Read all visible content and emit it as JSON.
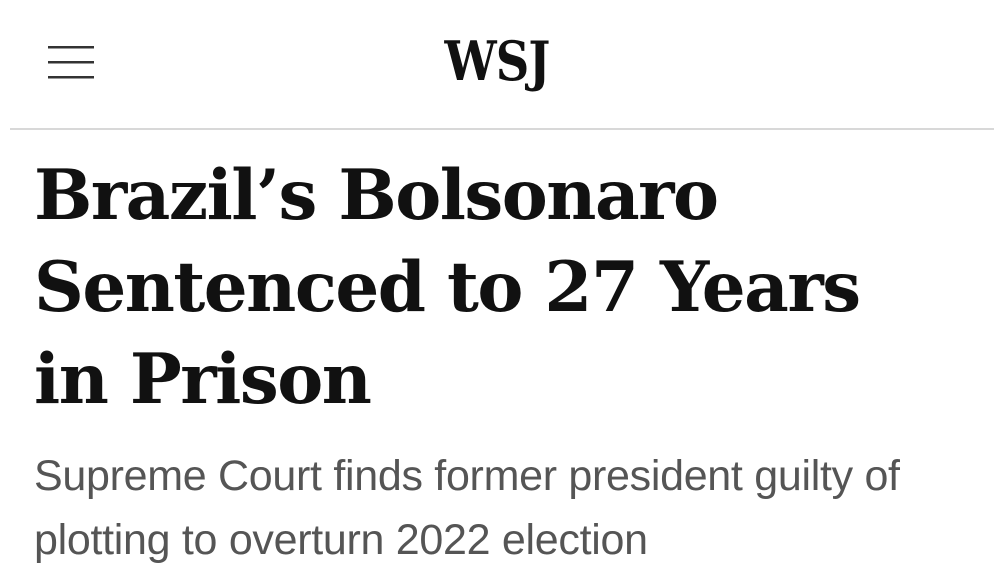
{
  "header": {
    "logo_text": "WSJ",
    "menu_icon": "hamburger-menu-icon"
  },
  "article": {
    "headline": "Brazil’s Bolsonaro Sentenced to 27 Years in Prison",
    "dek": "Supreme Court finds former president guilty of plotting to overturn 2022 election"
  },
  "colors": {
    "headline": "#111111",
    "dek": "#555555",
    "divider": "#d8d8d8",
    "background": "#ffffff"
  }
}
